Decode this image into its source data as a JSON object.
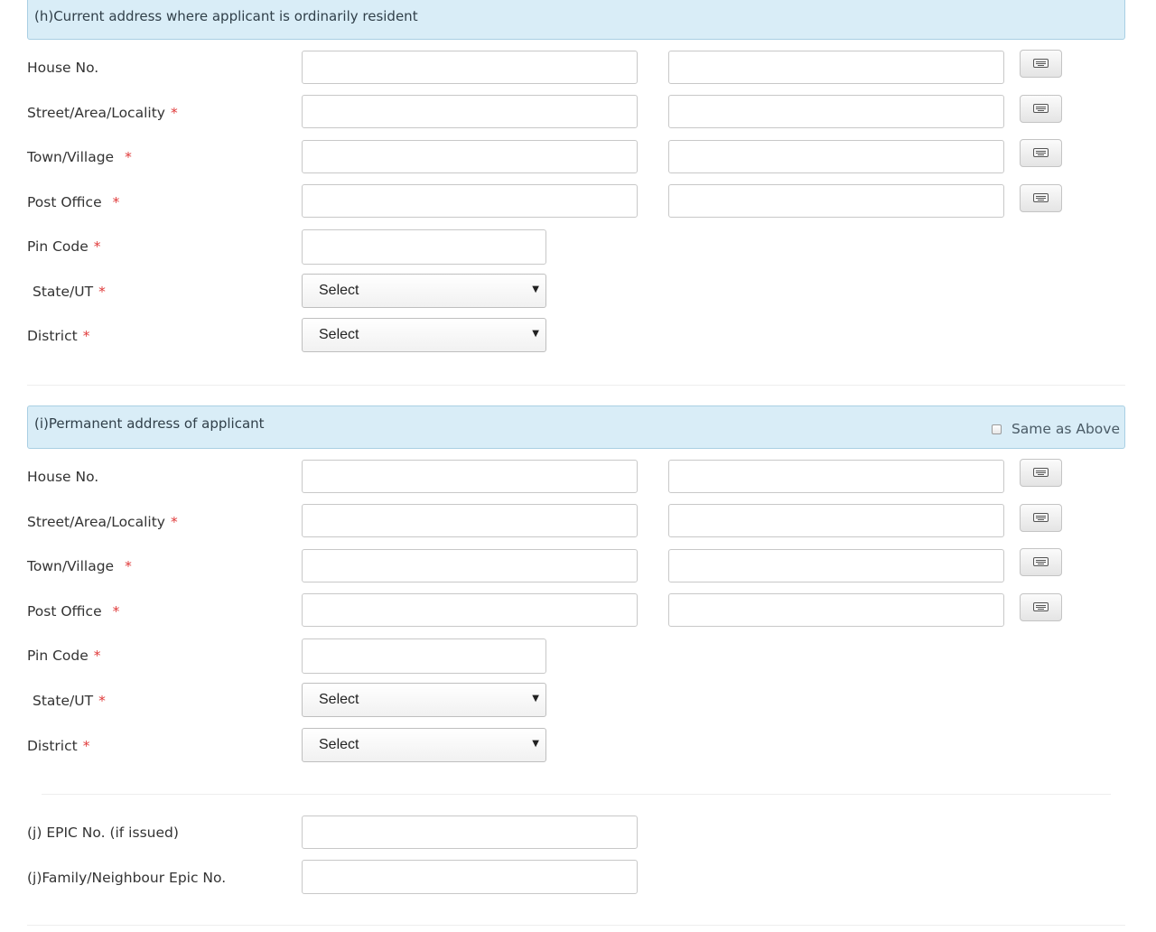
{
  "current_address": {
    "title": "(h)Current address where applicant is ordinarily resident",
    "house_no_label": "House No.",
    "street_label": "Street/Area/Locality",
    "town_label": "Town/Village",
    "post_office_label": "Post Office",
    "pin_code_label": "Pin Code",
    "state_label": "State/UT",
    "district_label": "District",
    "state_value": "Select",
    "district_value": "Select"
  },
  "permanent_address": {
    "title": "(i)Permanent address of applicant",
    "same_as_above_label": "Same as Above",
    "same_as_above_checked": false,
    "house_no_label": "House No.",
    "street_label": "Street/Area/Locality",
    "town_label": "Town/Village",
    "post_office_label": "Post Office",
    "pin_code_label": "Pin Code",
    "state_label": "State/UT",
    "district_label": "District",
    "state_value": "Select",
    "district_value": "Select"
  },
  "epic": {
    "epic_no_label": "(j) EPIC No. (if issued)",
    "family_epic_label": "(j)Family/Neighbour Epic No."
  },
  "required_marker": "*",
  "icons": {
    "keyboard": "keyboard-icon",
    "dropdown": "chevron-down-icon"
  },
  "colors": {
    "panel_background": "#d9edf7",
    "panel_border": "#a9cfe3",
    "required": "#e03a3a",
    "text": "#333333"
  }
}
